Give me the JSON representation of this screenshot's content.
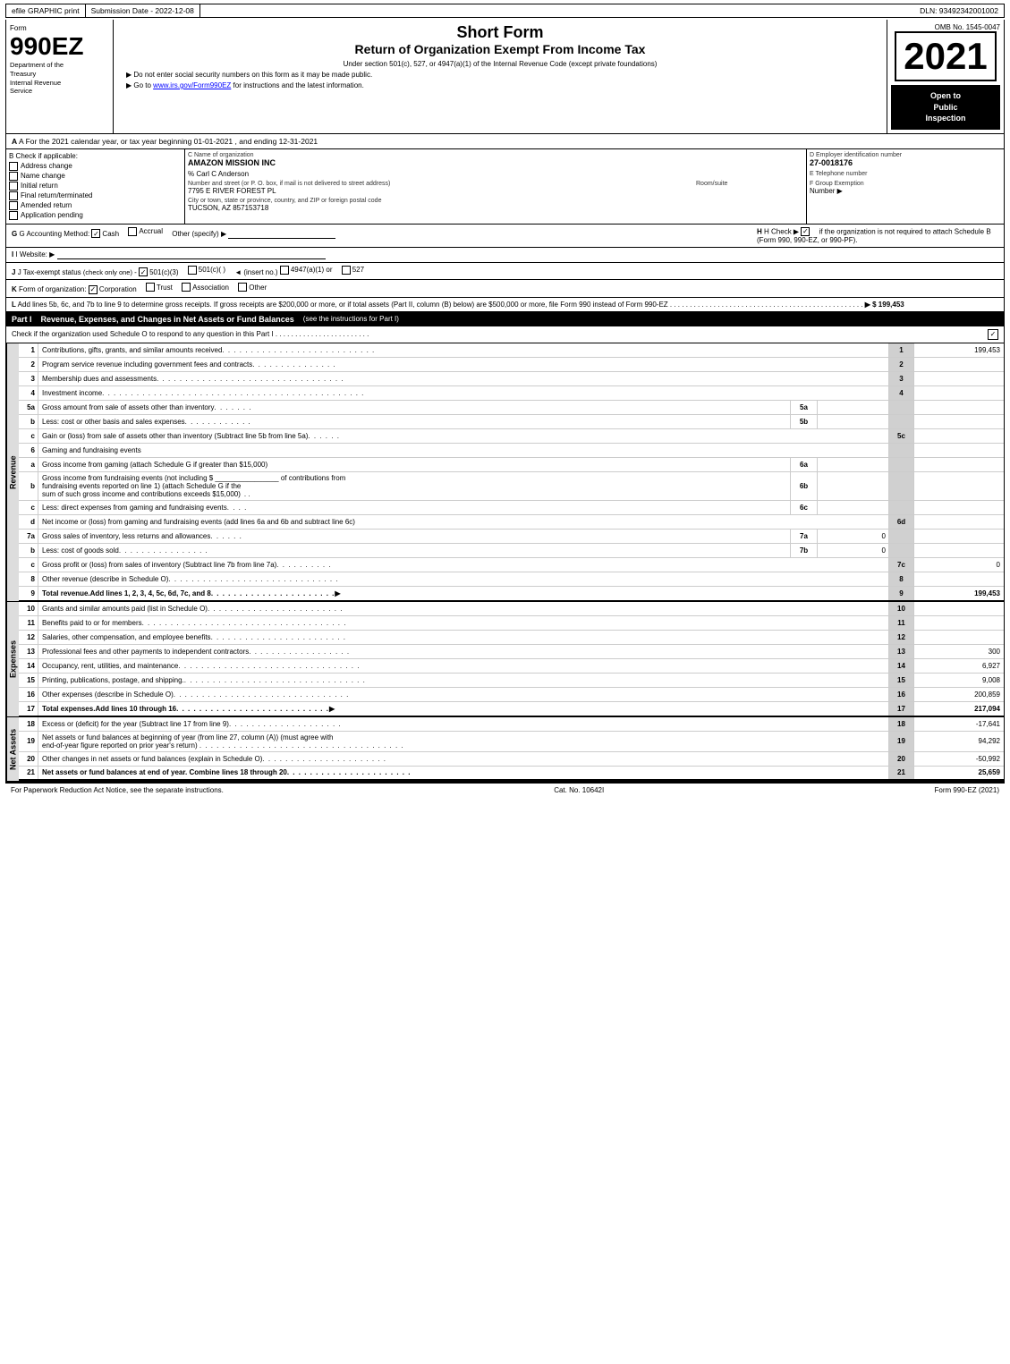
{
  "topBar": {
    "efile": "efile GRAPHIC print",
    "submission": "Submission Date - 2022-12-08",
    "dln": "DLN: 93492342001002"
  },
  "header": {
    "formLabel": "Form",
    "form990ez": "990EZ",
    "deptLine1": "Department of the",
    "deptLine2": "Treasury",
    "deptLine3": "Internal Revenue",
    "deptLine4": "Service",
    "shortForm": "Short Form",
    "returnTitle": "Return of Organization Exempt From Income Tax",
    "subtitle": "Under section 501(c), 527, or 4947(a)(1) of the Internal Revenue Code (except private foundations)",
    "note1": "▶ Do not enter social security numbers on this form as it may be made public.",
    "note2": "▶ Go to ",
    "link": "www.irs.gov/Form990EZ",
    "note2end": " for instructions and the latest information.",
    "ombNo": "OMB No. 1545-0047",
    "year": "2021",
    "openPublic": "Open to\nPublic\nInspection"
  },
  "sectionA": {
    "text": "A For the 2021 calendar year, or tax year beginning 01-01-2021 , and ending 12-31-2021"
  },
  "sectionB": {
    "label": "B Check if applicable:",
    "checkboxes": [
      {
        "id": "address-change",
        "label": "Address change",
        "checked": false
      },
      {
        "id": "name-change",
        "label": "Name change",
        "checked": false
      },
      {
        "id": "initial-return",
        "label": "Initial return",
        "checked": false
      },
      {
        "id": "final-return",
        "label": "Final return/terminated",
        "checked": false
      },
      {
        "id": "amended-return",
        "label": "Amended return",
        "checked": false
      },
      {
        "id": "application-pending",
        "label": "Application pending",
        "checked": false
      }
    ]
  },
  "sectionC": {
    "orgNameLabel": "C Name of organization",
    "orgName": "AMAZON MISSION INC",
    "careOfLabel": "% Carl C Anderson",
    "streetLabel": "Number and street (or P. O. box, if mail is not delivered to street address)",
    "streetValue": "7795 E RIVER FOREST PL",
    "roomSuiteLabel": "Room/suite",
    "roomSuiteValue": "",
    "cityLabel": "City or town, state or province, country, and ZIP or foreign postal code",
    "cityValue": "TUCSON, AZ  857153718"
  },
  "sectionD": {
    "label": "D Employer identification number",
    "ein": "27-0018176",
    "phoneLabel": "E Telephone number",
    "phoneValue": "",
    "groupLabel": "F Group Exemption",
    "groupValue": "Number  ▶"
  },
  "rowG": {
    "label": "G Accounting Method:",
    "cashLabel": "Cash",
    "cashChecked": true,
    "accrualLabel": "Accrual",
    "accrualChecked": false,
    "otherLabel": "Other (specify) ▶"
  },
  "rowH": {
    "label": "H Check ▶",
    "checkChecked": true,
    "text": "if the organization is not required to attach Schedule B (Form 990, 990-EZ, or 990-PF)."
  },
  "rowI": {
    "label": "I Website: ▶"
  },
  "rowJ": {
    "label": "J Tax-exempt status",
    "note": "(check only one)",
    "options": [
      {
        "label": "501(c)(3)",
        "checked": true
      },
      {
        "label": "501(c)(  )",
        "checked": false
      },
      {
        "label": "◄ (insert no.)",
        "checked": false
      },
      {
        "label": "4947(a)(1) or",
        "checked": false
      },
      {
        "label": "527",
        "checked": false
      }
    ]
  },
  "rowK": {
    "label": "K Form of organization:",
    "options": [
      {
        "label": "Corporation",
        "checked": true
      },
      {
        "label": "Trust",
        "checked": false
      },
      {
        "label": "Association",
        "checked": false
      },
      {
        "label": "Other",
        "checked": false
      }
    ]
  },
  "rowL": {
    "text": "L Add lines 5b, 6c, and 7b to line 9 to determine gross receipts. If gross receipts are $200,000 or more, or if total assets (Part II, column (B) below) are $500,000 or more, file Form 990 instead of Form 990-EZ",
    "dots": " . . . . . . . . . . . . . . . . . . . . . . . . . . . . . . . . . .",
    "arrow": "▶ $ 199,453"
  },
  "partI": {
    "label": "Part I",
    "title": "Revenue, Expenses, and Changes in Net Assets or Fund Balances",
    "seeInstructions": "(see the instructions for Part I)",
    "scheduleO": "Check if the organization used Schedule O to respond to any question in this Part I",
    "dots": " . . . . . . . . . . . . . . . . . . . . . . . .",
    "checkmark": "☑",
    "rows": [
      {
        "num": "1",
        "desc": "Contributions, gifts, grants, and similar amounts received",
        "dots": " . . . . . . . . . . . . . . . . . . . . . . . . .",
        "lineNum": "1",
        "amount": "199,453"
      },
      {
        "num": "2",
        "desc": "Program service revenue including government fees and contracts",
        "dots": " . . . . . . . . . . . . . . .",
        "lineNum": "2",
        "amount": ""
      },
      {
        "num": "3",
        "desc": "Membership dues and assessments",
        "dots": " . . . . . . . . . . . . . . . . . . . . . . . . . . . . . . . . .",
        "lineNum": "3",
        "amount": ""
      },
      {
        "num": "4",
        "desc": "Investment income",
        "dots": " . . . . . . . . . . . . . . . . . . . . . . . . . . . . . . . . . . . . . . . . . . . . . .",
        "lineNum": "4",
        "amount": ""
      }
    ],
    "row5a": {
      "num": "5a",
      "desc": "Gross amount from sale of assets other than inventory",
      "dots": " . . . . . . .",
      "subLabel": "5a",
      "midBox": "",
      "lineNum": "",
      "amount": ""
    },
    "row5b": {
      "num": "b",
      "desc": "Less: cost or other basis and sales expenses",
      "dots": " . . . . . . . . . . . .",
      "subLabel": "5b",
      "midBox": "",
      "lineNum": "",
      "amount": ""
    },
    "row5c": {
      "num": "c",
      "desc": "Gain or (loss) from sale of assets other than inventory (Subtract line 5b from line 5a)",
      "dots": " . . . . . .",
      "lineNum": "5c",
      "amount": ""
    },
    "row6": {
      "num": "6",
      "desc": "Gaming and fundraising events",
      "lineNum": "",
      "amount": ""
    },
    "row6a": {
      "num": "a",
      "desc": "Gross income from gaming (attach Schedule G if greater than $15,000)",
      "dots": "",
      "subLabel": "6a",
      "midBox": "",
      "lineNum": "",
      "amount": ""
    },
    "row6b_desc": "Gross income from fundraising events (not including $",
    "row6b_blank": "_______________",
    "row6b_of": "of contributions from",
    "row6b_line2": "fundraising events reported on line 1) (attach Schedule G if the",
    "row6b_line3": "sum of such gross income and contributions exceeds $15,000)",
    "row6b_dots": "  .  .  ",
    "row6b_subLabel": "6b",
    "row6c": {
      "num": "c",
      "desc": "Less: direct expenses from gaming and fundraising events",
      "dots": "  .  .  .  ",
      "subLabel": "6c",
      "midBox": "",
      "lineNum": "",
      "amount": ""
    },
    "row6d": {
      "num": "d",
      "desc": "Net income or (loss) from gaming and fundraising events (add lines 6a and 6b and subtract line 6c)",
      "lineNum": "6d",
      "amount": ""
    },
    "row7a": {
      "num": "7a",
      "desc": "Gross sales of inventory, less returns and allowances",
      "dots": " . . . . . .",
      "subLabel": "7a",
      "midBox": "0",
      "lineNum": "",
      "amount": ""
    },
    "row7b": {
      "num": "b",
      "desc": "Less: cost of goods sold",
      "dots": " . . . . . . . . . . . . . . . .",
      "subLabel": "7b",
      "midBox": "0",
      "lineNum": "",
      "amount": ""
    },
    "row7c": {
      "num": "c",
      "desc": "Gross profit or (loss) from sales of inventory (Subtract line 7b from line 7a)",
      "dots": " . . . . . . . . . .",
      "lineNum": "7c",
      "amount": "0"
    },
    "row8": {
      "num": "8",
      "desc": "Other revenue (describe in Schedule O)",
      "dots": " . . . . . . . . . . . . . . . . . . . . . . . . . . . . . .",
      "lineNum": "8",
      "amount": ""
    },
    "row9": {
      "num": "9",
      "desc": "Total revenue. Add lines 1, 2, 3, 4, 5c, 6d, 7c, and 8",
      "dots": " . . . . . . . . . . . . . . . . . . . . . .",
      "arrow": "▶",
      "lineNum": "9",
      "amount": "199,453",
      "bold": true
    }
  },
  "expenses": {
    "rows": [
      {
        "num": "10",
        "desc": "Grants and similar amounts paid (list in Schedule O)",
        "dots": " . . . . . . . . . . . . . . . . . . . . . . . .",
        "lineNum": "10",
        "amount": ""
      },
      {
        "num": "11",
        "desc": "Benefits paid to or for members",
        "dots": " . . . . . . . . . . . . . . . . . . . . . . . . . . . . . . . . . . . .",
        "lineNum": "11",
        "amount": ""
      },
      {
        "num": "12",
        "desc": "Salaries, other compensation, and employee benefits",
        "dots": " . . . . . . . . . . . . . . . . . . . . . . . .",
        "lineNum": "12",
        "amount": ""
      },
      {
        "num": "13",
        "desc": "Professional fees and other payments to independent contractors",
        "dots": " . . . . . . . . . . . . . . . . . .",
        "lineNum": "13",
        "amount": "300"
      },
      {
        "num": "14",
        "desc": "Occupancy, rent, utilities, and maintenance",
        "dots": " . . . . . . . . . . . . . . . . . . . . . . . . . . . . . . . .",
        "lineNum": "14",
        "amount": "6,927"
      },
      {
        "num": "15",
        "desc": "Printing, publications, postage, and shipping.",
        "dots": " . . . . . . . . . . . . . . . . . . . . . . . . . . . . . . . .",
        "lineNum": "15",
        "amount": "9,008"
      },
      {
        "num": "16",
        "desc": "Other expenses (describe in Schedule O)",
        "dots": " . . . . . . . . . . . . . . . . . . . . . . . . . . . . . . .",
        "lineNum": "16",
        "amount": "200,859"
      },
      {
        "num": "17",
        "desc": "Total expenses. Add lines 10 through 16",
        "dots": " . . . . . . . . . . . . . . . . . . . . . . . . . . .",
        "arrow": "▶",
        "lineNum": "17",
        "amount": "217,094",
        "bold": true
      }
    ]
  },
  "netAssets": {
    "rows": [
      {
        "num": "18",
        "desc": "Excess or (deficit) for the year (Subtract line 17 from line 9)",
        "dots": " . . . . . . . . . . . . . . . . . . . .",
        "lineNum": "18",
        "amount": "-17,641"
      },
      {
        "num": "19",
        "desc": "Net assets or fund balances at beginning of year (from line 27, column (A)) (must agree with end-of-year figure reported on prior year's return)",
        "dots": " . . . . . . . . . . . . . . . . . . . . . . . . . . . . . . . . . . . .",
        "lineNum": "19",
        "amount": "94,292"
      },
      {
        "num": "20",
        "desc": "Other changes in net assets or fund balances (explain in Schedule O)",
        "dots": " . . . . . . . . . . . . . . . . . . . . . .",
        "lineNum": "20",
        "amount": "-50,992"
      },
      {
        "num": "21",
        "desc": "Net assets or fund balances at end of year. Combine lines 18 through 20",
        "dots": " . . . . . . . . . . . . . . . . . . . . . .",
        "lineNum": "21",
        "amount": "25,659",
        "bold": true
      }
    ]
  },
  "footer": {
    "paperwork": "For Paperwork Reduction Act Notice, see the separate instructions.",
    "catNo": "Cat. No. 10642I",
    "formRef": "Form 990-EZ (2021)"
  }
}
